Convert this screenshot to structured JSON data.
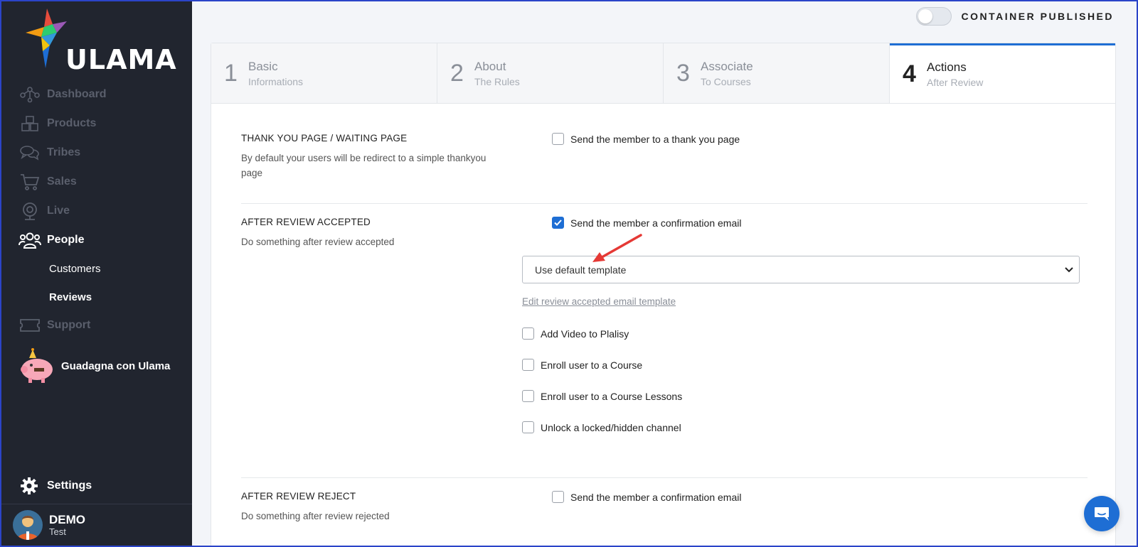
{
  "sidebar": {
    "logo_text": "ULAMA",
    "items": [
      {
        "label": "Dashboard",
        "icon": "network-icon"
      },
      {
        "label": "Products",
        "icon": "boxes-icon"
      },
      {
        "label": "Tribes",
        "icon": "chat-bubbles-icon"
      },
      {
        "label": "Sales",
        "icon": "cart-icon"
      },
      {
        "label": "Live",
        "icon": "webcam-icon"
      },
      {
        "label": "People",
        "icon": "people-icon"
      }
    ],
    "people_sub": [
      "Customers",
      "Reviews"
    ],
    "support": "Support",
    "promo": "Guadagna con Ulama",
    "settings": "Settings",
    "user": {
      "name": "DEMO",
      "sub": "Test"
    }
  },
  "header": {
    "publish_label": "CONTAINER PUBLISHED",
    "published": false
  },
  "steps": [
    {
      "num": "1",
      "title": "Basic",
      "sub": "Informations"
    },
    {
      "num": "2",
      "title": "About",
      "sub": "The Rules"
    },
    {
      "num": "3",
      "title": "Associate",
      "sub": "To Courses"
    },
    {
      "num": "4",
      "title": "Actions",
      "sub": "After Review"
    }
  ],
  "sections": {
    "thank_you": {
      "title": "THANK YOU PAGE / WAITING PAGE",
      "desc": "By default your users will be redirect to a simple thankyou page",
      "checkbox": "Send the member to a thank you page"
    },
    "accepted": {
      "title": "AFTER REVIEW ACCEPTED",
      "desc": "Do something after review accepted",
      "confirm_checkbox": "Send the member a confirmation email",
      "template_select": "Use default template",
      "edit_link": "Edit review accepted email template",
      "options": [
        "Add Video to Plalisy",
        "Enroll user to a Course",
        "Enroll user to a Course Lessons",
        "Unlock a locked/hidden channel"
      ]
    },
    "rejected": {
      "title": "AFTER REVIEW REJECT",
      "desc": "Do something after review rejected",
      "checkbox": "Send the member a confirmation email"
    }
  },
  "colors": {
    "accent": "#1e6ed4",
    "sidebar": "#21252f",
    "arrow": "#e53935"
  }
}
